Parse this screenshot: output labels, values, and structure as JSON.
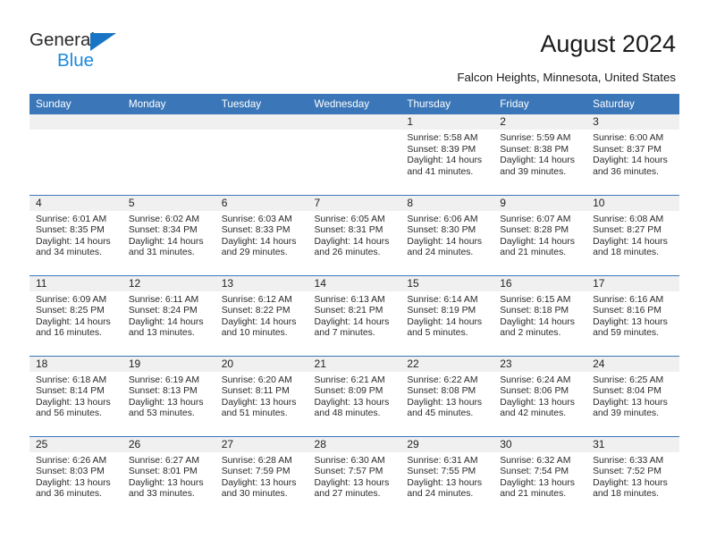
{
  "brand": {
    "name_top": "General",
    "name_bottom": "Blue",
    "triangle_color": "#1874c4",
    "blue_color": "#1a8ade"
  },
  "header": {
    "title": "August 2024",
    "subtitle": "Falcon Heights, Minnesota, United States"
  },
  "theme": {
    "header_row_bg": "#3b77b8",
    "header_row_text": "#ffffff",
    "daynum_band_bg": "#f0f0f0",
    "grid_line": "#3b77b8",
    "body_text": "#2a2a2a"
  },
  "weekdays": [
    "Sunday",
    "Monday",
    "Tuesday",
    "Wednesday",
    "Thursday",
    "Friday",
    "Saturday"
  ],
  "labels": {
    "sunrise": "Sunrise:",
    "sunset": "Sunset:",
    "daylight": "Daylight:"
  },
  "weeks": [
    [
      {
        "day": "",
        "sunrise": "",
        "sunset": "",
        "daylight": ""
      },
      {
        "day": "",
        "sunrise": "",
        "sunset": "",
        "daylight": ""
      },
      {
        "day": "",
        "sunrise": "",
        "sunset": "",
        "daylight": ""
      },
      {
        "day": "",
        "sunrise": "",
        "sunset": "",
        "daylight": ""
      },
      {
        "day": "1",
        "sunrise": "Sunrise: 5:58 AM",
        "sunset": "Sunset: 8:39 PM",
        "daylight": "Daylight: 14 hours and 41 minutes."
      },
      {
        "day": "2",
        "sunrise": "Sunrise: 5:59 AM",
        "sunset": "Sunset: 8:38 PM",
        "daylight": "Daylight: 14 hours and 39 minutes."
      },
      {
        "day": "3",
        "sunrise": "Sunrise: 6:00 AM",
        "sunset": "Sunset: 8:37 PM",
        "daylight": "Daylight: 14 hours and 36 minutes."
      }
    ],
    [
      {
        "day": "4",
        "sunrise": "Sunrise: 6:01 AM",
        "sunset": "Sunset: 8:35 PM",
        "daylight": "Daylight: 14 hours and 34 minutes."
      },
      {
        "day": "5",
        "sunrise": "Sunrise: 6:02 AM",
        "sunset": "Sunset: 8:34 PM",
        "daylight": "Daylight: 14 hours and 31 minutes."
      },
      {
        "day": "6",
        "sunrise": "Sunrise: 6:03 AM",
        "sunset": "Sunset: 8:33 PM",
        "daylight": "Daylight: 14 hours and 29 minutes."
      },
      {
        "day": "7",
        "sunrise": "Sunrise: 6:05 AM",
        "sunset": "Sunset: 8:31 PM",
        "daylight": "Daylight: 14 hours and 26 minutes."
      },
      {
        "day": "8",
        "sunrise": "Sunrise: 6:06 AM",
        "sunset": "Sunset: 8:30 PM",
        "daylight": "Daylight: 14 hours and 24 minutes."
      },
      {
        "day": "9",
        "sunrise": "Sunrise: 6:07 AM",
        "sunset": "Sunset: 8:28 PM",
        "daylight": "Daylight: 14 hours and 21 minutes."
      },
      {
        "day": "10",
        "sunrise": "Sunrise: 6:08 AM",
        "sunset": "Sunset: 8:27 PM",
        "daylight": "Daylight: 14 hours and 18 minutes."
      }
    ],
    [
      {
        "day": "11",
        "sunrise": "Sunrise: 6:09 AM",
        "sunset": "Sunset: 8:25 PM",
        "daylight": "Daylight: 14 hours and 16 minutes."
      },
      {
        "day": "12",
        "sunrise": "Sunrise: 6:11 AM",
        "sunset": "Sunset: 8:24 PM",
        "daylight": "Daylight: 14 hours and 13 minutes."
      },
      {
        "day": "13",
        "sunrise": "Sunrise: 6:12 AM",
        "sunset": "Sunset: 8:22 PM",
        "daylight": "Daylight: 14 hours and 10 minutes."
      },
      {
        "day": "14",
        "sunrise": "Sunrise: 6:13 AM",
        "sunset": "Sunset: 8:21 PM",
        "daylight": "Daylight: 14 hours and 7 minutes."
      },
      {
        "day": "15",
        "sunrise": "Sunrise: 6:14 AM",
        "sunset": "Sunset: 8:19 PM",
        "daylight": "Daylight: 14 hours and 5 minutes."
      },
      {
        "day": "16",
        "sunrise": "Sunrise: 6:15 AM",
        "sunset": "Sunset: 8:18 PM",
        "daylight": "Daylight: 14 hours and 2 minutes."
      },
      {
        "day": "17",
        "sunrise": "Sunrise: 6:16 AM",
        "sunset": "Sunset: 8:16 PM",
        "daylight": "Daylight: 13 hours and 59 minutes."
      }
    ],
    [
      {
        "day": "18",
        "sunrise": "Sunrise: 6:18 AM",
        "sunset": "Sunset: 8:14 PM",
        "daylight": "Daylight: 13 hours and 56 minutes."
      },
      {
        "day": "19",
        "sunrise": "Sunrise: 6:19 AM",
        "sunset": "Sunset: 8:13 PM",
        "daylight": "Daylight: 13 hours and 53 minutes."
      },
      {
        "day": "20",
        "sunrise": "Sunrise: 6:20 AM",
        "sunset": "Sunset: 8:11 PM",
        "daylight": "Daylight: 13 hours and 51 minutes."
      },
      {
        "day": "21",
        "sunrise": "Sunrise: 6:21 AM",
        "sunset": "Sunset: 8:09 PM",
        "daylight": "Daylight: 13 hours and 48 minutes."
      },
      {
        "day": "22",
        "sunrise": "Sunrise: 6:22 AM",
        "sunset": "Sunset: 8:08 PM",
        "daylight": "Daylight: 13 hours and 45 minutes."
      },
      {
        "day": "23",
        "sunrise": "Sunrise: 6:24 AM",
        "sunset": "Sunset: 8:06 PM",
        "daylight": "Daylight: 13 hours and 42 minutes."
      },
      {
        "day": "24",
        "sunrise": "Sunrise: 6:25 AM",
        "sunset": "Sunset: 8:04 PM",
        "daylight": "Daylight: 13 hours and 39 minutes."
      }
    ],
    [
      {
        "day": "25",
        "sunrise": "Sunrise: 6:26 AM",
        "sunset": "Sunset: 8:03 PM",
        "daylight": "Daylight: 13 hours and 36 minutes."
      },
      {
        "day": "26",
        "sunrise": "Sunrise: 6:27 AM",
        "sunset": "Sunset: 8:01 PM",
        "daylight": "Daylight: 13 hours and 33 minutes."
      },
      {
        "day": "27",
        "sunrise": "Sunrise: 6:28 AM",
        "sunset": "Sunset: 7:59 PM",
        "daylight": "Daylight: 13 hours and 30 minutes."
      },
      {
        "day": "28",
        "sunrise": "Sunrise: 6:30 AM",
        "sunset": "Sunset: 7:57 PM",
        "daylight": "Daylight: 13 hours and 27 minutes."
      },
      {
        "day": "29",
        "sunrise": "Sunrise: 6:31 AM",
        "sunset": "Sunset: 7:55 PM",
        "daylight": "Daylight: 13 hours and 24 minutes."
      },
      {
        "day": "30",
        "sunrise": "Sunrise: 6:32 AM",
        "sunset": "Sunset: 7:54 PM",
        "daylight": "Daylight: 13 hours and 21 minutes."
      },
      {
        "day": "31",
        "sunrise": "Sunrise: 6:33 AM",
        "sunset": "Sunset: 7:52 PM",
        "daylight": "Daylight: 13 hours and 18 minutes."
      }
    ]
  ]
}
